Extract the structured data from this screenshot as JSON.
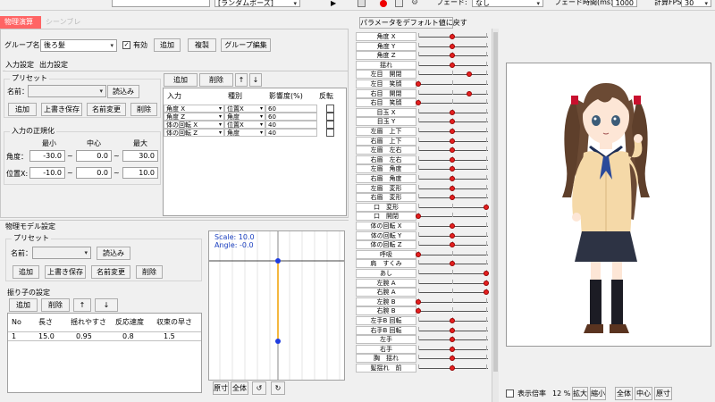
{
  "top": {
    "random_pose": "[ランダムポーズ]",
    "fade_label": "フェード:",
    "fade_value": "なし",
    "fade_time_label": "フェード時間(ms):",
    "fade_time_value": "1000",
    "fps_label": "計算FPS",
    "fps_value": "30"
  },
  "tabs": [
    "物理演算",
    "シーンブレンド"
  ],
  "group": {
    "label": "グループ名：",
    "value": "後ろ髪",
    "enabled_label": "有効",
    "add": "追加",
    "copy": "複製",
    "edit": "グループ編集"
  },
  "subtabs": [
    "入力設定",
    "出力設定"
  ],
  "preset": {
    "title": "プリセット",
    "name_label": "名前：",
    "load": "読込み",
    "add": "追加",
    "overwrite": "上書き保存",
    "rename": "名前変更",
    "delete": "削除"
  },
  "input_buttons": {
    "add": "追加",
    "delete": "削除",
    "up": "↑",
    "down": "↓"
  },
  "input_table": {
    "headers": [
      "入力",
      "種別",
      "影響度(%)",
      "反転"
    ],
    "rows": [
      {
        "input": "角度 X",
        "type": "位置X",
        "weight": "60"
      },
      {
        "input": "角度 Z",
        "type": "角度",
        "weight": "60"
      },
      {
        "input": "体の回転 X",
        "type": "位置X",
        "weight": "40"
      },
      {
        "input": "体の回転 Z",
        "type": "角度",
        "weight": "40"
      }
    ]
  },
  "normalize": {
    "title": "入力の正規化",
    "min": "最小",
    "mid": "中心",
    "max": "最大",
    "angle_label": "角度：",
    "angle": [
      "-30.0",
      "0.0",
      "30.0"
    ],
    "pos_label": "位置X:",
    "pos": [
      "-10.0",
      "0.0",
      "10.0"
    ]
  },
  "physics": {
    "title": "物理モデル設定",
    "preset_title": "プリセット",
    "name_label": "名前：",
    "load": "読込み",
    "add": "追加",
    "overwrite": "上書き保存",
    "rename": "名前変更",
    "delete": "削除",
    "pendulum_title": "振り子の設定",
    "p_add": "追加",
    "p_delete": "削除",
    "p_up": "↑",
    "p_down": "↓",
    "table_headers": [
      "No",
      "長さ",
      "揺れやすさ",
      "反応速度",
      "収束の早さ"
    ],
    "table_rows": [
      [
        "1",
        "15.0",
        "0.95",
        "0.8",
        "1.5"
      ]
    ],
    "scale_text": "Scale: 10.0",
    "angle_text": "Angle: -0.0",
    "plot_buttons": [
      "原寸",
      "全体",
      "↺",
      "↻"
    ]
  },
  "params": {
    "reset_button": "パラメータをデフォルト値に戻す",
    "rows": [
      {
        "label": "角度 X",
        "v": 0.5,
        "red": true
      },
      {
        "label": "角度 Y",
        "v": 0.5,
        "red": true
      },
      {
        "label": "角度 Z",
        "v": 0.5,
        "red": true
      },
      {
        "label": "揺れ",
        "v": 0.5,
        "red": true
      },
      {
        "label": "左目　開閉",
        "v": 0.75,
        "red": true
      },
      {
        "label": "左目　笑顔",
        "v": 0.0,
        "red": true
      },
      {
        "label": "右目　開閉",
        "v": 0.75,
        "red": true
      },
      {
        "label": "右目　笑顔",
        "v": 0.0,
        "red": true
      },
      {
        "label": "目玉 X",
        "v": 0.5,
        "red": true
      },
      {
        "label": "目玉 Y",
        "v": 0.5,
        "red": true
      },
      {
        "label": "左眉　上下",
        "v": 0.5,
        "red": true
      },
      {
        "label": "右眉　上下",
        "v": 0.5,
        "red": true
      },
      {
        "label": "左眉　左右",
        "v": 0.5,
        "red": true
      },
      {
        "label": "右眉　左右",
        "v": 0.5,
        "red": true
      },
      {
        "label": "左眉　角度",
        "v": 0.5,
        "red": true
      },
      {
        "label": "右眉　角度",
        "v": 0.5,
        "red": true
      },
      {
        "label": "左眉　変形",
        "v": 0.5,
        "red": true
      },
      {
        "label": "右眉　変形",
        "v": 0.5,
        "red": true
      },
      {
        "label": "口　変形",
        "v": 1.0,
        "red": true
      },
      {
        "label": "口　開閉",
        "v": 0.0,
        "red": true
      },
      {
        "label": "体の回転 X",
        "v": 0.5,
        "red": true
      },
      {
        "label": "体の回転 Y",
        "v": 0.5,
        "red": true
      },
      {
        "label": "体の回転 Z",
        "v": 0.5,
        "red": true
      },
      {
        "label": "呼吸",
        "v": 0.0,
        "red": true
      },
      {
        "label": "肩　すくみ",
        "v": 0.5,
        "red": true
      },
      {
        "label": "あし",
        "v": 1.0,
        "red": true
      },
      {
        "label": "左腕 A",
        "v": 1.0,
        "red": true
      },
      {
        "label": "右腕 A",
        "v": 1.0,
        "red": true
      },
      {
        "label": "左腕 B",
        "v": 0.0,
        "red": true
      },
      {
        "label": "右腕 B",
        "v": 0.0,
        "red": true
      },
      {
        "label": "左手B 回転",
        "v": 0.5,
        "red": true
      },
      {
        "label": "右手B 回転",
        "v": 0.5,
        "red": true
      },
      {
        "label": "左手",
        "v": 0.5,
        "red": true
      },
      {
        "label": "右手",
        "v": 0.5,
        "red": true
      },
      {
        "label": "胸　揺れ",
        "v": 0.5,
        "red": true
      },
      {
        "label": "髪揺れ　前",
        " v": 0.5,
        "red": true
      }
    ]
  },
  "preview": {
    "show_ratio_label": "表示倍率",
    "zoom": "12 %",
    "zoom_in": "拡大",
    "zoom_out": "縮小",
    "all": "全体",
    "center": "中心",
    "original": "原寸"
  }
}
